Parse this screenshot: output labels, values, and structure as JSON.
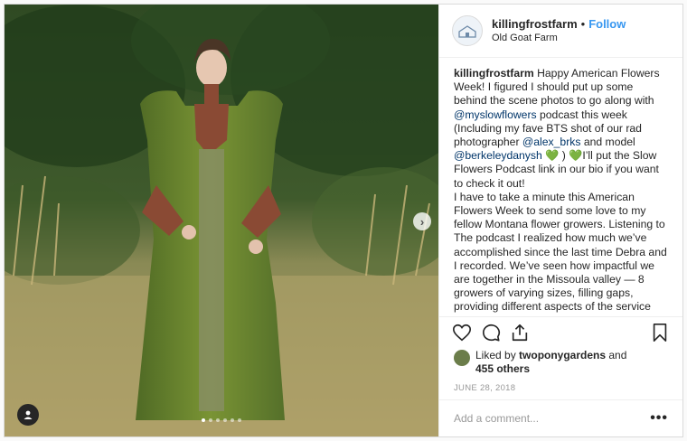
{
  "post": {
    "username": "killingfrostfarm",
    "bullet": "•",
    "follow_label": "Follow",
    "location": "Old Goat Farm",
    "caption": {
      "username": "killingfrostfarm",
      "t1": " Happy American Flowers Week! I figured I should put up some behind the scene photos to go along with ",
      "m1": "@myslowflowers",
      "t2": " podcast this week (Including my fave BTS shot of our rad photographer ",
      "m2": "@alex_brks",
      "t3": " and model ",
      "m3": "@berkeleydanysh",
      "t4": " 💚 ) 💚I’ll put the Slow Flowers Podcast link in our bio if you want to check it out!",
      "t5": "I have to take a minute this American Flowers Week to send some love to my fellow Montana flower growers. Listening to The podcast I realized how much we’ve accomplished since the last time Debra and I recorded. We’ve seen how impactful we are together in the Missoula valley — 8 growers of varying sizes, filling gaps, providing different aspects of the service chain, stepping out into bigger design gigs with the support of their grower friends"
    },
    "likes": {
      "prefix": "Liked by ",
      "user": "twoponygardens",
      "and": " and",
      "others": "455 others"
    },
    "date": "JUNE 28, 2018",
    "comment_placeholder": "Add a comment...",
    "more_label": "•••",
    "next_label": "›"
  },
  "carousel": {
    "slides": 6,
    "active_index": 0
  },
  "icons": {
    "like": "heart-icon",
    "comment": "comment-bubble-icon",
    "share": "share-icon",
    "save": "bookmark-icon",
    "tag": "user-tag-icon"
  },
  "colors": {
    "link": "#3897f0",
    "mention": "#003569",
    "muted": "#999999"
  }
}
